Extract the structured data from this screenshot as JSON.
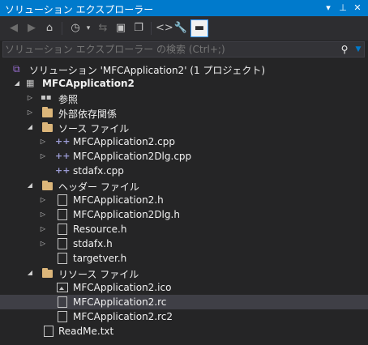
{
  "title": "ソリューション エクスプローラー",
  "title_buttons": {
    "dropdown": "▾",
    "pin": "⊥",
    "close": "✕"
  },
  "search": {
    "placeholder": "ソリューション エクスプローラー の検索 (Ctrl+;)"
  },
  "colors": {
    "accent": "#007acc",
    "background": "#252526",
    "selection": "#3f3f46",
    "cpp_icon": "#9b9bd4",
    "folder": "#dcb67a"
  },
  "tree": [
    {
      "label": "ソリューション 'MFCApplication2' (1 プロジェクト)",
      "icon": "solution-icon",
      "expander": "",
      "bold": false
    },
    {
      "label": "MFCApplication2",
      "icon": "project-icon",
      "expander": "◢",
      "bold": true
    },
    {
      "label": "参照",
      "icon": "references-icon",
      "expander": "▷",
      "bold": false
    },
    {
      "label": "外部依存関係",
      "icon": "external-dependencies-icon",
      "expander": "▷",
      "bold": false
    },
    {
      "label": "ソース ファイル",
      "icon": "folder-icon",
      "expander": "◢",
      "bold": false
    },
    {
      "label": "MFCApplication2.cpp",
      "icon": "cpp-file-icon",
      "expander": "▷",
      "bold": false
    },
    {
      "label": "MFCApplication2Dlg.cpp",
      "icon": "cpp-file-icon",
      "expander": "▷",
      "bold": false
    },
    {
      "label": "stdafx.cpp",
      "icon": "cpp-file-icon",
      "expander": "",
      "bold": false
    },
    {
      "label": "ヘッダー ファイル",
      "icon": "folder-icon",
      "expander": "◢",
      "bold": false
    },
    {
      "label": "MFCApplication2.h",
      "icon": "header-file-icon",
      "expander": "▷",
      "bold": false
    },
    {
      "label": "MFCApplication2Dlg.h",
      "icon": "header-file-icon",
      "expander": "▷",
      "bold": false
    },
    {
      "label": "Resource.h",
      "icon": "header-file-icon",
      "expander": "▷",
      "bold": false
    },
    {
      "label": "stdafx.h",
      "icon": "header-file-icon",
      "expander": "▷",
      "bold": false
    },
    {
      "label": "targetver.h",
      "icon": "header-file-icon",
      "expander": "",
      "bold": false
    },
    {
      "label": "リソース ファイル",
      "icon": "folder-icon",
      "expander": "◢",
      "bold": false
    },
    {
      "label": "MFCApplication2.ico",
      "icon": "image-file-icon",
      "expander": "",
      "bold": false
    },
    {
      "label": "MFCApplication2.rc",
      "icon": "resource-file-icon",
      "expander": "",
      "bold": false,
      "selected": true
    },
    {
      "label": "MFCApplication2.rc2",
      "icon": "resource-file-icon",
      "expander": "",
      "bold": false
    },
    {
      "label": "ReadMe.txt",
      "icon": "text-file-icon",
      "expander": "",
      "bold": false
    }
  ]
}
